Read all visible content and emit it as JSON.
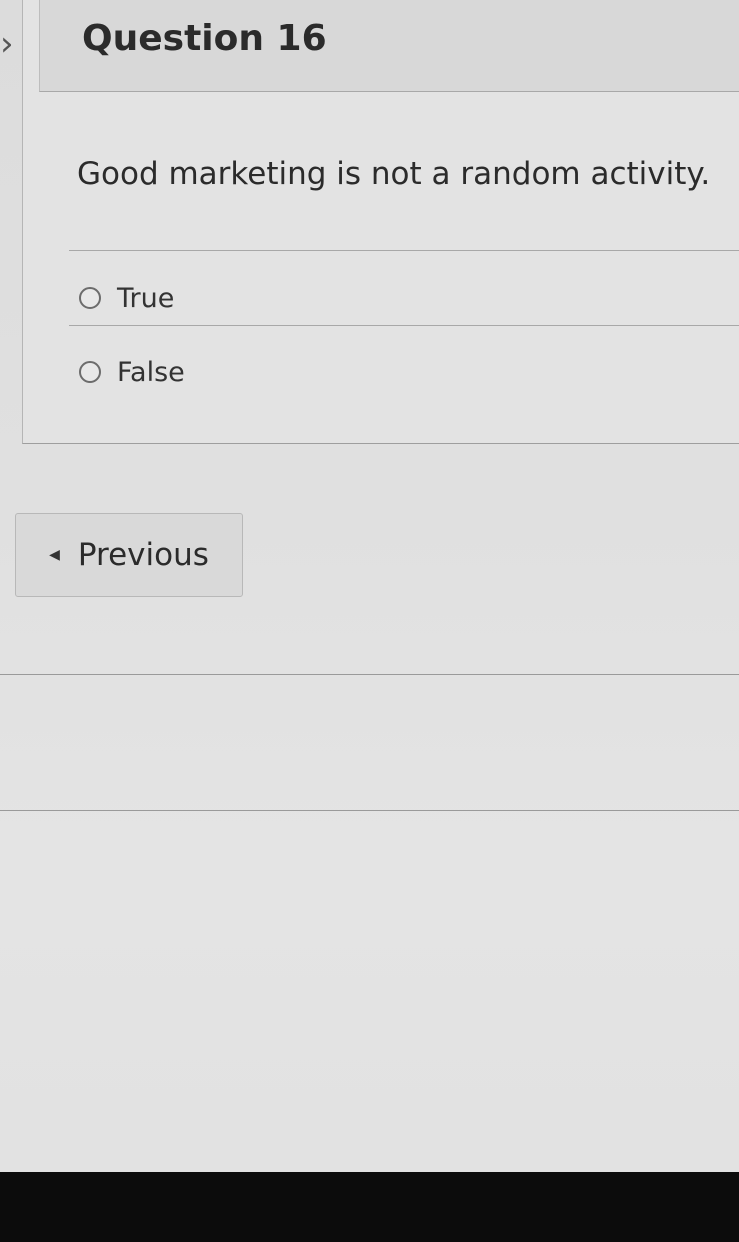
{
  "question": {
    "title": "Question 16",
    "text": "Good marketing is not a random activity.",
    "options": [
      {
        "label": "True",
        "selected": false
      },
      {
        "label": "False",
        "selected": false
      }
    ]
  },
  "navigation": {
    "previous_label": "Previous"
  },
  "icons": {
    "collapse": "chevron-right-icon",
    "previous": "caret-left-icon"
  }
}
